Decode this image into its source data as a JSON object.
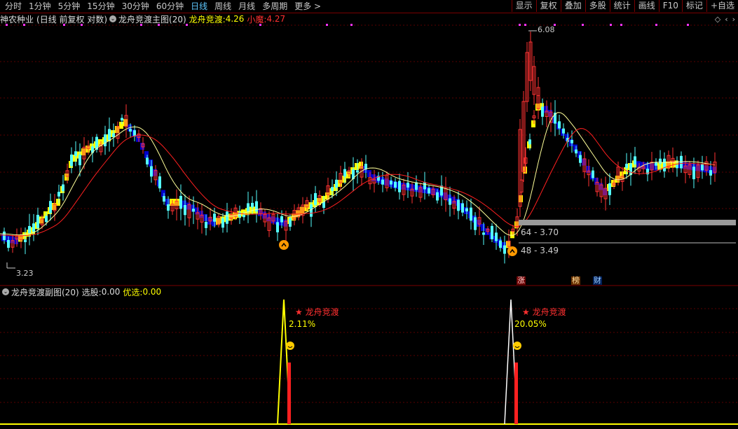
{
  "toolbar": {
    "periods": [
      "分时",
      "1分钟",
      "5分钟",
      "15分钟",
      "30分钟",
      "60分钟",
      "日线",
      "周线",
      "月线",
      "多周期",
      "更多 >"
    ],
    "active": "日线",
    "buttons": [
      "显示",
      "复权",
      "叠加",
      "多股",
      "统计",
      "画线",
      "F10",
      "标记",
      "+自选"
    ]
  },
  "main_header": {
    "stock": "神农种业",
    "mode": "(日线 前复权 对数)",
    "indicator": "龙舟竞渡主图(20)",
    "line1_label": "龙舟竞渡:",
    "line1_value": "4.26",
    "line2_label": "小魔:",
    "line2_value": "4.27"
  },
  "sub_header": {
    "indicator": "龙舟竞渡副图(20)",
    "pick_label": "选股:",
    "pick_value": "0.00",
    "best_label": "优选:",
    "best_value": "0.00"
  },
  "price_labels": {
    "high": "6.08",
    "low": "3.23",
    "zone1": "64 - 3.70",
    "zone2": "48 - 3.49"
  },
  "tags": {
    "zhang": "涨",
    "bang": "榜",
    "cai": "财"
  },
  "signals": [
    {
      "text": "★ 龙舟竞渡",
      "pct": "2.11%"
    },
    {
      "text": "★ 龙舟竞渡",
      "pct": "20.05%"
    }
  ],
  "colors": {
    "up": "#ff3232",
    "down": "#54ffff",
    "ribbon_up": "#ffff00",
    "ribbon_down": "#0000cc",
    "ma_short": "#ffff99",
    "ma_long": "#ff2020"
  }
}
